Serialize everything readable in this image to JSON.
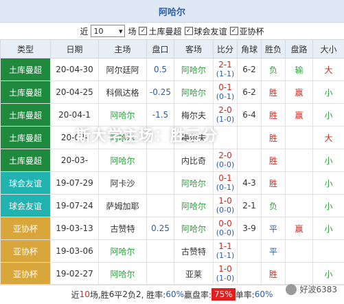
{
  "title": "阿哈尔",
  "filter": {
    "prefix": "近",
    "count": "10",
    "suffix": "场",
    "checks": [
      {
        "label": "土库曼超",
        "checked": true
      },
      {
        "label": "球会友谊",
        "checked": true
      },
      {
        "label": "亚协杯",
        "checked": true
      }
    ]
  },
  "columns": [
    "类型",
    "日期",
    "主场",
    "盘口",
    "客场",
    "比分",
    "角球",
    "胜负",
    "盘路",
    "大小"
  ],
  "rows": [
    {
      "comp": "土库曼超",
      "cls": "g",
      "date": "20-04-30",
      "home": "阿尔廷阿",
      "home_c": "",
      "line": "0.5",
      "away": "阿哈尔",
      "away_c": "grn",
      "ft": "2-1",
      "ht": "(1-1)",
      "ft_c": "red",
      "corner": "6-2",
      "res": "负",
      "res_c": "grn",
      "hcp": "输",
      "hcp_c": "grn",
      "ou": "大",
      "ou_c": "red"
    },
    {
      "comp": "土库曼超",
      "cls": "g",
      "date": "20-04-25",
      "home": "科佩达格",
      "home_c": "",
      "line": "-0.25",
      "away": "阿哈尔",
      "away_c": "grn",
      "ft": "0-1",
      "ht": "(0-1)",
      "ft_c": "red",
      "corner": "6-2",
      "res": "胜",
      "res_c": "red",
      "hcp": "赢",
      "hcp_c": "red",
      "ou": "小",
      "ou_c": "grn"
    },
    {
      "comp": "土库曼超",
      "cls": "g",
      "date": "20-04-1",
      "home": "阿哈尔",
      "home_c": "grn",
      "line": "-1.5",
      "away": "梅尔夫",
      "away_c": "",
      "ft": "2-0",
      "ht": "(1-0)",
      "ft_c": "red",
      "corner": "6-4",
      "res": "胜",
      "res_c": "red",
      "hcp": "赢",
      "hcp_c": "red",
      "ou": "小",
      "ou_c": "grn"
    },
    {
      "comp": "土库曼超",
      "cls": "g",
      "date": "20-03-",
      "home": "阿哈尔",
      "home_c": "grn",
      "line": "",
      "away": "梅尔夫",
      "away_c": "",
      "ft": "",
      "ht": "",
      "ft_c": "red",
      "corner": "",
      "res": "胜",
      "res_c": "red",
      "hcp": "",
      "hcp_c": "red",
      "ou": "大",
      "ou_c": "red"
    },
    {
      "comp": "土库曼超",
      "cls": "g",
      "date": "20-03-",
      "home": "阿哈尔",
      "home_c": "grn",
      "line": "",
      "away": "内比奇",
      "away_c": "",
      "ft": "2-0",
      "ht": "(0-0)",
      "ft_c": "red",
      "corner": "",
      "res": "胜",
      "res_c": "red",
      "hcp": "",
      "hcp_c": "red",
      "ou": "小",
      "ou_c": "grn"
    },
    {
      "comp": "球会友谊",
      "cls": "t",
      "date": "19-07-29",
      "home": "阿卡沙",
      "home_c": "",
      "line": "",
      "away": "阿哈尔",
      "away_c": "grn",
      "ft": "0-1",
      "ht": "(0-1)",
      "ft_c": "red",
      "corner": "4-3",
      "res": "胜",
      "res_c": "red",
      "hcp": "",
      "hcp_c": "red",
      "ou": "小",
      "ou_c": "grn"
    },
    {
      "comp": "球会友谊",
      "cls": "t",
      "date": "19-07-24",
      "home": "萨姆加耶",
      "home_c": "",
      "line": "",
      "away": "阿哈尔",
      "away_c": "grn",
      "ft": "1-0",
      "ht": "(0-0)",
      "ft_c": "red",
      "corner": "2-1",
      "res": "负",
      "res_c": "grn",
      "hcp": "",
      "hcp_c": "red",
      "ou": "小",
      "ou_c": "grn"
    },
    {
      "comp": "亚协杯",
      "cls": "y",
      "date": "19-03-13",
      "home": "古赞特",
      "home_c": "",
      "line": "0.25",
      "away": "阿哈尔",
      "away_c": "grn",
      "ft": "0-0",
      "ht": "(0-0)",
      "ft_c": "red",
      "corner": "3-9",
      "res": "平",
      "res_c": "blu",
      "hcp": "赢",
      "hcp_c": "red",
      "ou": "小",
      "ou_c": "grn"
    },
    {
      "comp": "亚协杯",
      "cls": "y",
      "date": "19-03-06",
      "home": "阿哈尔",
      "home_c": "grn",
      "line": "",
      "away": "古赞特",
      "away_c": "",
      "ft": "1-1",
      "ht": "(1-1)",
      "ft_c": "red",
      "corner": "",
      "res": "平",
      "res_c": "blu",
      "hcp": "",
      "hcp_c": "red",
      "ou": "",
      "ou_c": "grn"
    },
    {
      "comp": "亚协杯",
      "cls": "y",
      "date": "19-02-27",
      "home": "阿哈尔",
      "home_c": "grn",
      "line": "",
      "away": "亚莱",
      "away_c": "",
      "ft": "1-0",
      "ht": "(1-0)",
      "ft_c": "red",
      "corner": "",
      "res": "胜",
      "res_c": "red",
      "hcp": "",
      "hcp_c": "red",
      "ou": "小",
      "ou_c": "grn"
    }
  ],
  "footer": {
    "text1": "近",
    "n": "10",
    "text2": "场,胜",
    "w": "6",
    "text3": "平",
    "d": "2",
    "text4": "负",
    "l": "2",
    "text5": ", 胜率:",
    "win_rate": "60%",
    "text6": " 赢盘率:",
    "hcp_rate": "75%",
    "text7": " 单率:",
    "odd_rate": "60%"
  },
  "overlay": "斯大学主场：胜三分",
  "watermark": "好波6383"
}
